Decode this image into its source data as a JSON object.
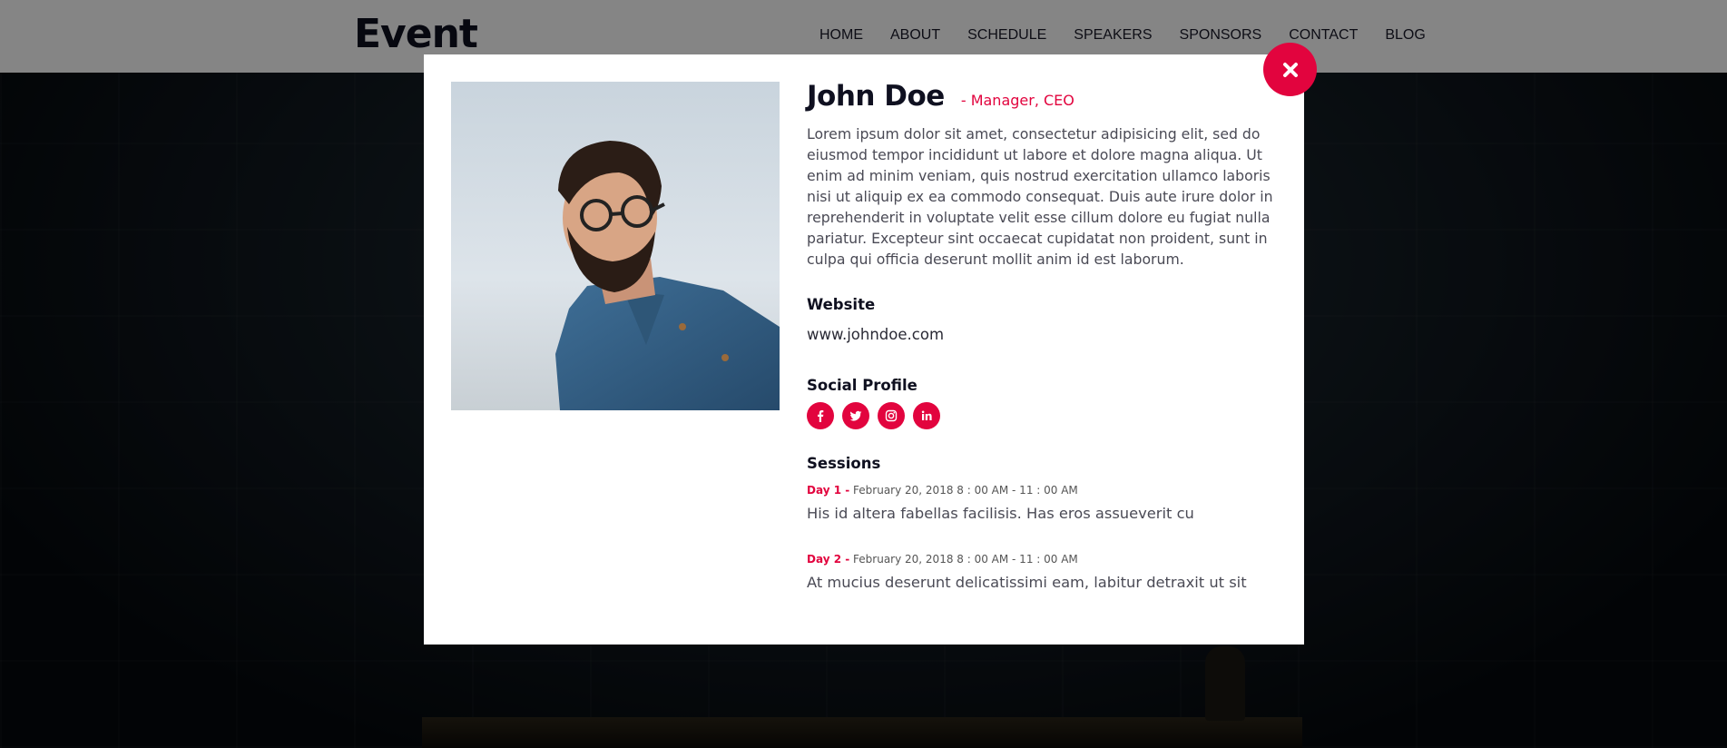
{
  "header": {
    "logo": "Event",
    "nav": [
      "HOME",
      "ABOUT",
      "SCHEDULE",
      "SPEAKERS",
      "SPONSORS",
      "CONTACT",
      "BLOG"
    ]
  },
  "modal": {
    "name": "John Doe",
    "role": "- Manager, CEO",
    "bio": "Lorem ipsum dolor sit amet, consectetur adipisicing elit, sed do eiusmod tempor incididunt ut labore et dolore magna aliqua. Ut enim ad minim veniam, quis nostrud exercitation ullamco laboris nisi ut aliquip ex ea commodo consequat. Duis aute irure dolor in reprehenderit in voluptate velit esse cillum dolore eu fugiat nulla pariatur. Excepteur sint occaecat cupidatat non proident, sunt in culpa qui officia deserunt mollit anim id est laborum.",
    "website_heading": "Website",
    "website": "www.johndoe.com",
    "social_heading": "Social Profile",
    "social": [
      {
        "icon": "facebook-icon"
      },
      {
        "icon": "twitter-icon"
      },
      {
        "icon": "instagram-icon"
      },
      {
        "icon": "linkedin-icon"
      }
    ],
    "sessions_heading": "Sessions",
    "sessions": [
      {
        "day": "Day 1 -",
        "time": "February 20, 2018 8 : 00 AM - 11 : 00 AM",
        "title": "His id altera fabellas facilisis. Has eros assueverit cu"
      },
      {
        "day": "Day 2 -",
        "time": "February 20, 2018 8 : 00 AM - 11 : 00 AM",
        "title": "At mucius deserunt delicatissimi eam, labitur detraxit ut sit"
      }
    ]
  },
  "colors": {
    "accent": "#e2043e",
    "heading": "#0f1020",
    "body_text": "#4a4a55"
  }
}
